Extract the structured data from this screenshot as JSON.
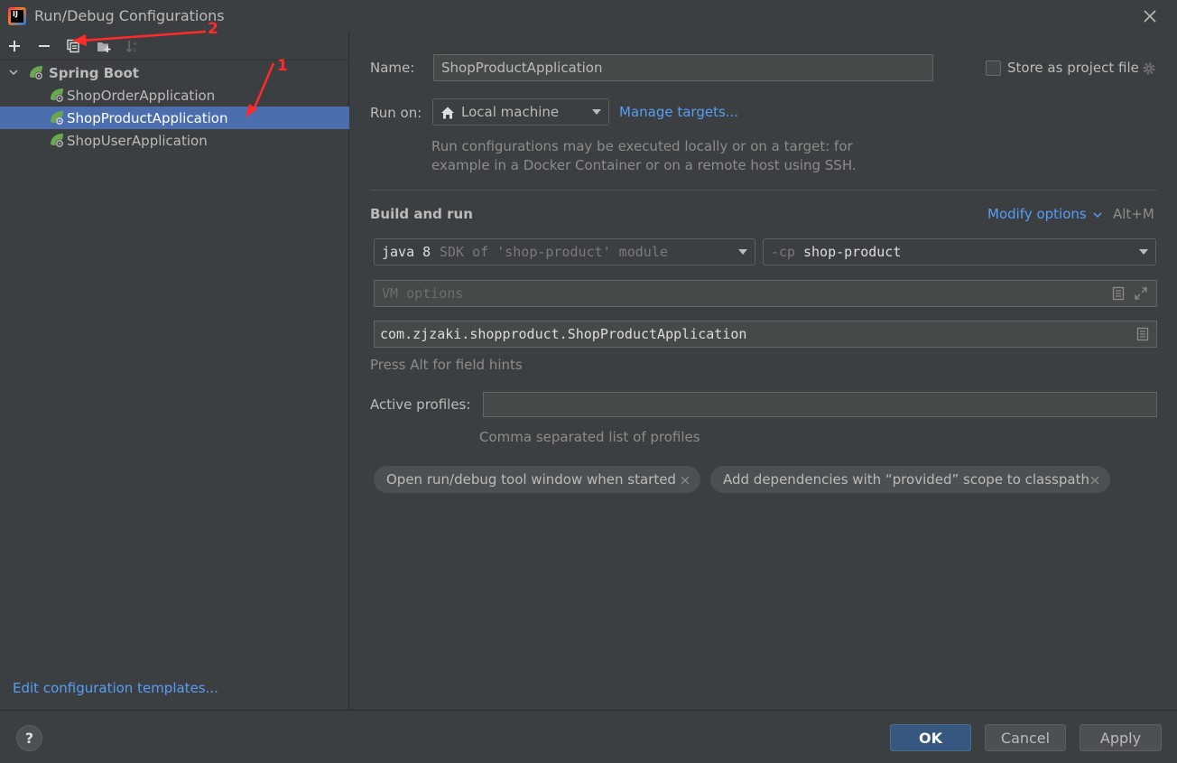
{
  "window": {
    "title": "Run/Debug Configurations",
    "icon": "intellij-idea-icon"
  },
  "toolbar": {
    "icons": [
      "add-icon",
      "remove-icon",
      "copy-icon",
      "new-folder-icon",
      "sort-icon"
    ]
  },
  "tree": {
    "group_label": "Spring Boot",
    "items": [
      {
        "label": "ShopOrderApplication",
        "selected": false
      },
      {
        "label": "ShopProductApplication",
        "selected": true
      },
      {
        "label": "ShopUserApplication",
        "selected": false
      }
    ]
  },
  "left_footer": {
    "edit_templates_link": "Edit configuration templates..."
  },
  "form": {
    "name_label": "Name:",
    "name_value": "ShopProductApplication",
    "store_label": "Store as project file",
    "store_checked": false,
    "run_on_label": "Run on:",
    "run_on_value": "Local machine",
    "manage_targets_link": "Manage targets...",
    "run_on_hint_line1": "Run configurations may be executed locally or on a target: for",
    "run_on_hint_line2": "example in a Docker Container or on a remote host using SSH.",
    "build_and_run_title": "Build and run",
    "modify_options_link": "Modify options",
    "modify_options_shortcut": "Alt+M",
    "sdk_main": "java 8",
    "sdk_detail": "SDK of 'shop-product' module",
    "cp_prefix": "-cp",
    "cp_value": "shop-product",
    "vm_options_placeholder": "VM options",
    "main_class_value": "com.zjzaki.shopproduct.ShopProductApplication",
    "field_hints_text": "Press Alt for field hints",
    "active_profiles_label": "Active profiles:",
    "active_profiles_value": "",
    "active_profiles_hint": "Comma separated list of profiles",
    "chips": [
      "Open run/debug tool window when started",
      "Add dependencies with “provided” scope to classpath"
    ]
  },
  "buttons": {
    "help": "?",
    "ok": "OK",
    "cancel": "Cancel",
    "apply": "Apply"
  },
  "annotations": {
    "arrow1_label": "1",
    "arrow2_label": "2",
    "color": "#ff2a2a"
  },
  "colors": {
    "background": "#3c3f41",
    "selection": "#4b6eaf",
    "link": "#589df6",
    "primary_button": "#365880"
  }
}
